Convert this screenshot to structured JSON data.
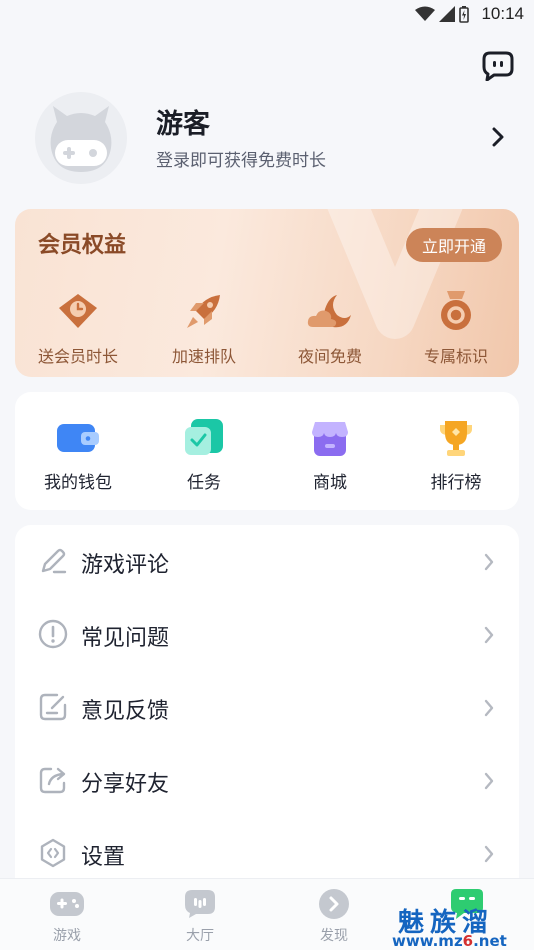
{
  "status_bar": {
    "time": "10:14"
  },
  "profile": {
    "name": "游客",
    "subtitle": "登录即可获得免费时长"
  },
  "vip": {
    "title": "会员权益",
    "open_button": "立即开通",
    "items": [
      {
        "label": "送会员时长",
        "icon": "ticket-clock-icon"
      },
      {
        "label": "加速排队",
        "icon": "rocket-icon"
      },
      {
        "label": "夜间免费",
        "icon": "moon-cloud-icon"
      },
      {
        "label": "专属标识",
        "icon": "medal-icon"
      }
    ]
  },
  "quick_actions": [
    {
      "label": "我的钱包",
      "icon": "wallet-icon"
    },
    {
      "label": "任务",
      "icon": "task-icon"
    },
    {
      "label": "商城",
      "icon": "store-icon"
    },
    {
      "label": "排行榜",
      "icon": "trophy-icon"
    }
  ],
  "menu": [
    {
      "label": "游戏评论",
      "icon": "pencil-icon"
    },
    {
      "label": "常见问题",
      "icon": "exclamation-icon"
    },
    {
      "label": "意见反馈",
      "icon": "feedback-icon"
    },
    {
      "label": "分享好友",
      "icon": "share-icon"
    },
    {
      "label": "设置",
      "icon": "settings-hex-icon"
    }
  ],
  "bottom_nav": [
    {
      "label": "游戏",
      "icon": "gamepad-icon"
    },
    {
      "label": "大厅",
      "icon": "chat-hall-icon"
    },
    {
      "label": "发现",
      "icon": "discover-icon"
    },
    {
      "label": "",
      "icon": "robot-face-icon"
    }
  ],
  "watermark": {
    "title": "魅族溜",
    "url_prefix": "www.mz",
    "url_mid": "6",
    "url_suffix": ".net"
  },
  "colors": {
    "vip_accent": "#cc8458",
    "vip_text": "#8a4a27",
    "active_tab": "#2ecc71"
  }
}
